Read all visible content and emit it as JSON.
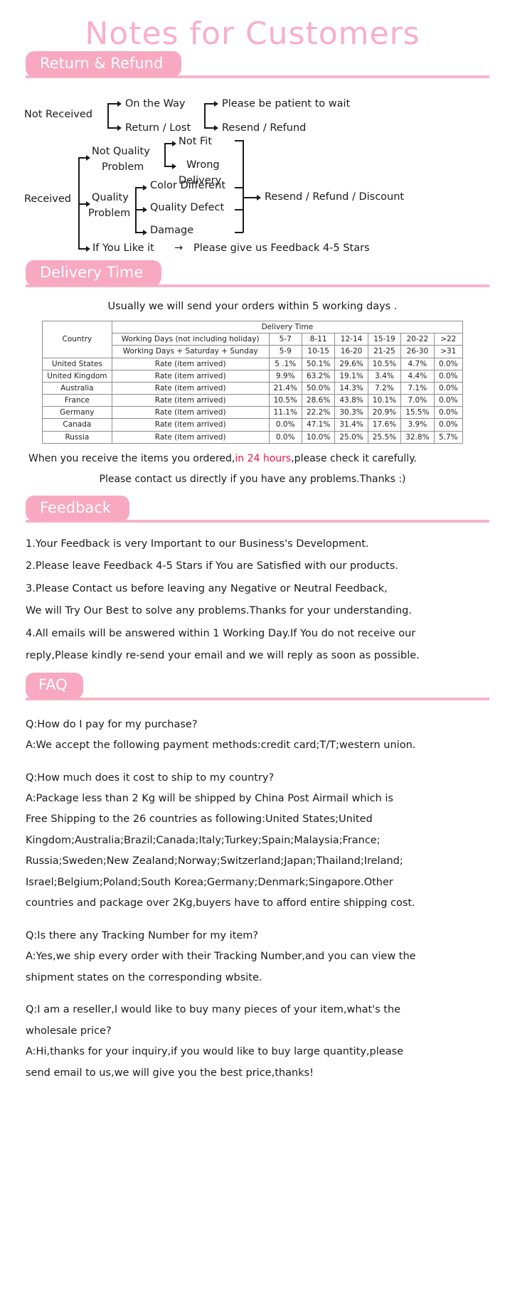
{
  "title": "Notes for Customers",
  "colors": {
    "accent": "#f8a8c0",
    "accent_light": "#f9afc6",
    "rule": "#f7b4c8",
    "highlight": "#e8174b"
  },
  "sections": {
    "return_refund": {
      "label": "Return & Refund"
    },
    "delivery_time": {
      "label": "Delivery Time"
    },
    "feedback": {
      "label": "Feedback"
    },
    "faq": {
      "label": "FAQ"
    }
  },
  "flow": {
    "not_received": "Not Received",
    "on_the_way": "On the Way",
    "return_lost": "Return / Lost",
    "be_patient": "Please be patient to wait",
    "resend_refund": "Resend / Refund",
    "received": "Received",
    "not_quality_l1": "Not Quality",
    "not_quality_l2": "Problem",
    "not_fit": "Not Fit",
    "wrong_l1": "Wrong",
    "wrong_l2": "Delivery",
    "quality_l1": "Quality",
    "quality_l2": "Problem",
    "color_different": "Color Different",
    "quality_defect": "Quality Defect",
    "damage": "Damage",
    "resend_refund_discount": "Resend / Refund / Discount",
    "if_you_like": "If You Like it",
    "arrow_glyph": "→",
    "feedback_stars": "Please give us Feedback 4-5 Stars"
  },
  "delivery": {
    "intro": "Usually we will send your orders within 5 working days .",
    "header_country": "Country",
    "header_delivery_time": "Delivery Time",
    "row_working_days": "Working Days (not including holiday)",
    "row_working_days_weekend": "Working Days + Saturday + Sunday",
    "rate_label": "Rate (item arrived)",
    "ranges_working": [
      "5-7",
      "8-11",
      "12-14",
      "15-19",
      "20-22",
      ">22"
    ],
    "ranges_all": [
      "5-9",
      "10-15",
      "16-20",
      "21-25",
      "26-30",
      ">31"
    ],
    "rows": [
      {
        "country": "United States",
        "rates": [
          "5 .1%",
          "50.1%",
          "29.6%",
          "10.5%",
          "4.7%",
          "0.0%"
        ]
      },
      {
        "country": "United Kingdom",
        "rates": [
          "9.9%",
          "63.2%",
          "19.1%",
          "3.4%",
          "4.4%",
          "0.0%"
        ]
      },
      {
        "country": "Australia",
        "rates": [
          "21.4%",
          "50.0%",
          "14.3%",
          "7.2%",
          "7.1%",
          "0.0%"
        ]
      },
      {
        "country": "France",
        "rates": [
          "10.5%",
          "28.6%",
          "43.8%",
          "10.1%",
          "7.0%",
          "0.0%"
        ]
      },
      {
        "country": "Germany",
        "rates": [
          "11.1%",
          "22.2%",
          "30.3%",
          "20.9%",
          "15.5%",
          "0.0%"
        ]
      },
      {
        "country": "Canada",
        "rates": [
          "0.0%",
          "47.1%",
          "31.4%",
          "17.6%",
          "3.9%",
          "0.0%"
        ]
      },
      {
        "country": "Russia",
        "rates": [
          "0.0%",
          "10.0%",
          "25.0%",
          "25.5%",
          "32.8%",
          "5.7%"
        ]
      }
    ],
    "note_pre": "When you receive the items you ordered,",
    "note_highlight": "in 24 hours",
    "note_post": ",please check it carefully.",
    "note_second": "Please contact us directly if you have any problems.Thanks :)"
  },
  "feedback_lines": [
    "1.Your Feedback is very Important to our Business's Development.",
    "2.Please leave Feedback 4-5 Stars if You are Satisfied with our products.",
    "3.Please Contact us before leaving any Negative or Neutral Feedback,",
    "We will Try Our Best to solve any problems.Thanks for your understanding.",
    "4.All emails will be answered within 1 Working Day.If You do not receive our",
    "reply,Please kindly re-send your email and we will reply as soon as possible."
  ],
  "faq_lines": [
    "Q:How do I pay for my purchase?",
    "A:We accept the following payment methods:credit card;T/T;western union.",
    "",
    "Q:How much does it cost to ship to my country?",
    "A:Package less than 2 Kg will be shipped by China Post Airmail which is",
    "Free Shipping  to the 26 countries as following:United States;United",
    "Kingdom;Australia;Brazil;Canada;Italy;Turkey;Spain;Malaysia;France;",
    "Russia;Sweden;New Zealand;Norway;Switzerland;Japan;Thailand;Ireland;",
    "Israel;Belgium;Poland;South Korea;Germany;Denmark;Singapore.Other",
    "countries and package over 2Kg,buyers have to afford entire shipping cost.",
    "",
    "Q:Is there any Tracking Number for my item?",
    "A:Yes,we ship every order with their Tracking Number,and you can view the",
    "shipment states on the corresponding wbsite.",
    "",
    "Q:I am a reseller,I would like to buy many pieces of your item,what's the",
    "wholesale price?",
    "A:Hi,thanks for your inquiry,if you would like to buy large quantity,please",
    "send email to us,we will give you the best price,thanks!"
  ]
}
